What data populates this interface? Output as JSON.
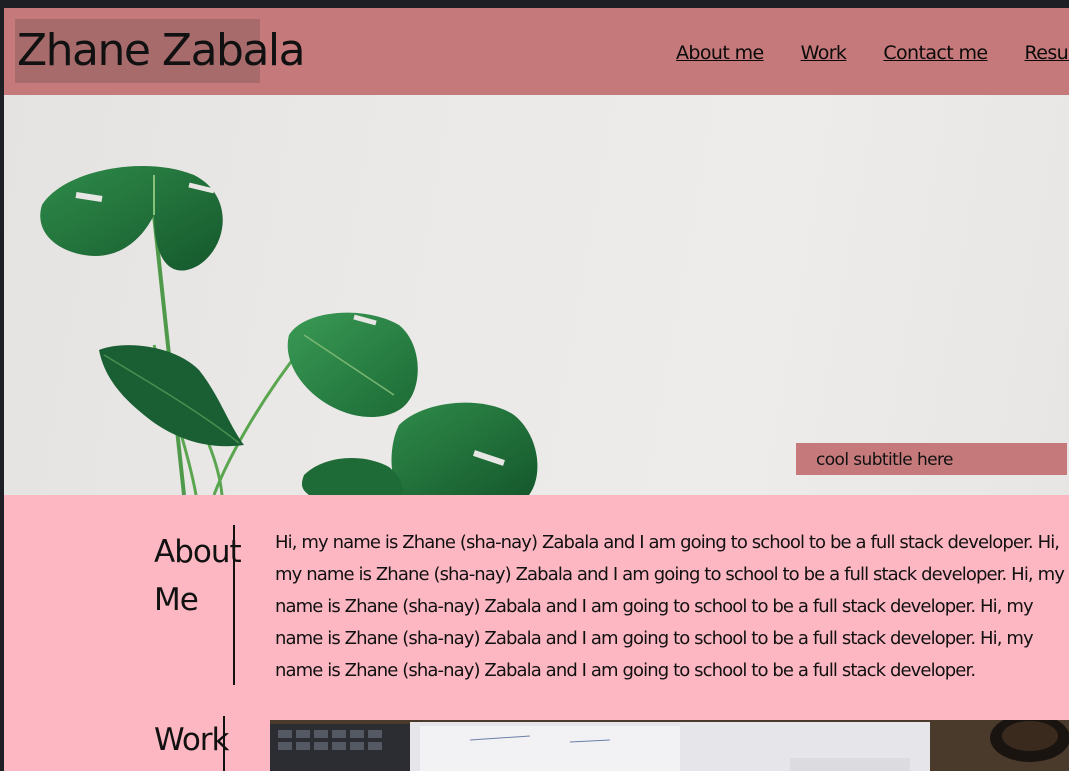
{
  "brand": {
    "name": "Zhane Zabala"
  },
  "nav": {
    "items": [
      {
        "label": "About me"
      },
      {
        "label": "Work"
      },
      {
        "label": "Contact me"
      },
      {
        "label": "Resume"
      }
    ]
  },
  "hero": {
    "image": "monstera-plant-photo",
    "subtitle": "cool subtitle here"
  },
  "about": {
    "heading": "About Me",
    "body": "Hi, my name is Zhane (sha-nay) Zabala and I am going to school to be a full stack developer. Hi, my name is Zhane (sha-nay) Zabala and I am going to school to be a full stack developer. Hi, my name is Zhane (sha-nay) Zabala and I am going to school to be a full stack developer. Hi, my name is Zhane (sha-nay) Zabala and I am going to school to be a full stack developer. Hi, my name is Zhane (sha-nay) Zabala and I am going to school to be a full stack developer."
  },
  "work": {
    "heading": "Work",
    "image": "desk-laptop-calendar-photo"
  },
  "colors": {
    "header": "#c5797b",
    "brand_box": "#a76b6c",
    "page_background": "#fdb7c3",
    "text": "#111111"
  }
}
